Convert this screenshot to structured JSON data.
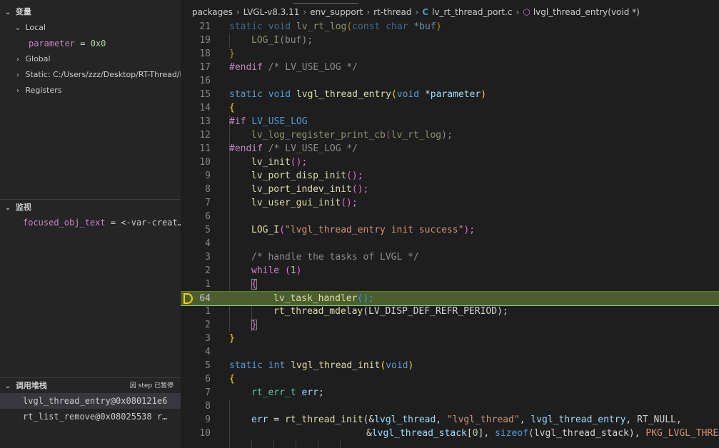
{
  "sidebar": {
    "variables_header": "变量",
    "local_label": "Local",
    "local_var": {
      "name": "parameter",
      "eq": " = ",
      "value": "0x0"
    },
    "global_label": "Global",
    "static_label": "Static: C:/Users/zzz/Desktop/RT-Thread/Pr",
    "registers_label": "Registers",
    "watch_header": "监视",
    "watch_item": {
      "name": "focused_obj_text",
      "value": " = <-var-creat…"
    },
    "callstack_header": "调用堆栈",
    "callstack_status": "因 step 已暂停",
    "callstack_frames": [
      "lvgl_thread_entry@0x080121e6",
      "rt_list_remove@0x08025538  r…"
    ]
  },
  "breadcrumb": {
    "items": [
      "packages",
      "LVGL-v8.3.11",
      "env_support",
      "rt-thread"
    ],
    "file": "lv_rt_thread_port.c",
    "symbol": "lvgl_thread_entry(void *)",
    "file_icon": "C",
    "symbol_icon": "cube-icon"
  },
  "code": {
    "line_numbers": [
      "21",
      "19",
      "18",
      "17",
      "16",
      "15",
      "14",
      "13",
      "12",
      "11",
      "10",
      "9",
      "8",
      "7",
      "6",
      "5",
      "4",
      "3",
      "2",
      "1",
      "64",
      "1",
      "2",
      "3",
      "4",
      "5",
      "6",
      "7",
      "8",
      "9",
      "10"
    ],
    "current_line": "64",
    "lines_text": {
      "l0": [
        "static ",
        "void ",
        "lv_rt_log",
        "(",
        "const ",
        "char ",
        "*buf",
        ")"
      ],
      "l2": [
        "LOG_I",
        "(buf);"
      ],
      "l3": [
        "}"
      ],
      "l4": [
        "#endif ",
        "/* LV_USE_LOG */"
      ],
      "l6": [
        "static ",
        "void ",
        "lvgl_thread_entry",
        "(",
        "void ",
        "*",
        "parameter",
        ")"
      ],
      "l7": [
        "{"
      ],
      "l8": [
        "#if ",
        "LV_USE_LOG"
      ],
      "l9": [
        "lv_log_register_print_cb",
        "(",
        "lv_rt_log",
        ");"
      ],
      "l10": [
        "#endif ",
        "/* LV_USE_LOG */"
      ],
      "l11": [
        "lv_init",
        "();"
      ],
      "l12": [
        "lv_port_disp_init",
        "();"
      ],
      "l13": [
        "lv_port_indev_init",
        "();"
      ],
      "l14": [
        "lv_user_gui_init",
        "();"
      ],
      "l16": [
        "LOG_I",
        "(",
        "\"lvgl_thread_entry init success\"",
        ");"
      ],
      "l18": [
        "/* handle the tasks of LVGL */"
      ],
      "l19": [
        "while ",
        "(",
        "1",
        ")"
      ],
      "l20": [
        "{"
      ],
      "l21": [
        "lv_task_handler",
        "();"
      ],
      "l22": [
        "rt_thread_mdelay",
        "(LV_DISP_DEF_REFR_PERIOD);"
      ],
      "l23": [
        "}"
      ],
      "l24": [
        "}"
      ],
      "l26": [
        "static ",
        "int ",
        "lvgl_thread_init",
        "(",
        "void",
        ")"
      ],
      "l27": [
        "{"
      ],
      "l28": [
        "rt_err_t ",
        "err",
        ";"
      ],
      "l30": [
        "err",
        " = ",
        "rt_thread_init",
        "(&",
        "lvgl_thread",
        ", ",
        "\"lvgl_thread\"",
        ", ",
        "lvgl_thread_entry",
        ", RT_NULL,"
      ],
      "l31": [
        "&",
        "lvgl_thread_stack",
        "[",
        "0",
        "], ",
        "sizeof",
        "(lvgl_thread_stack), ",
        "PKG_LVGL_THREAD_PRIO"
      ]
    }
  }
}
